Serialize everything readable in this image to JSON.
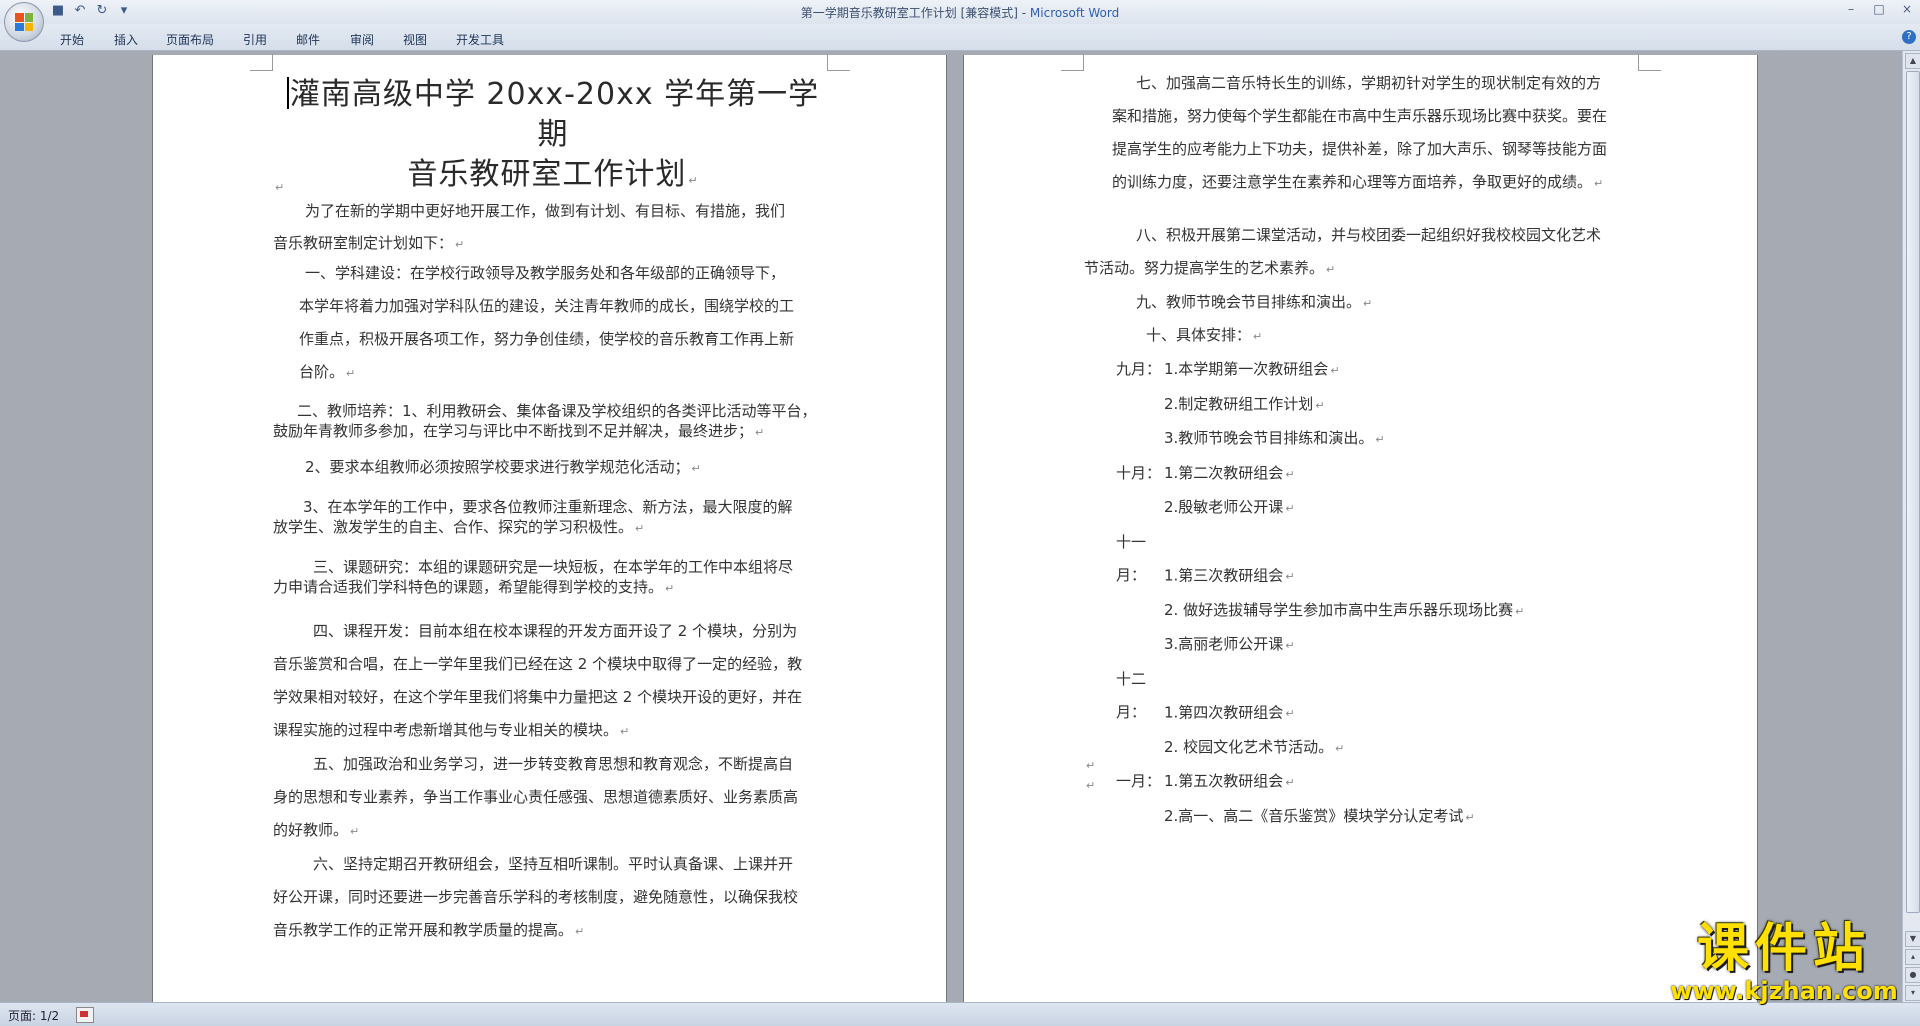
{
  "window": {
    "title": "第一学期音乐教研室工作计划 [兼容模式] - ",
    "app_name": "Microsoft Word",
    "controls": [
      "–",
      "□",
      "×"
    ]
  },
  "quick_access": [
    "save-icon",
    "undo-icon",
    "redo-icon",
    "customize-icon"
  ],
  "ribbon": {
    "tabs": [
      "开始",
      "插入",
      "页面布局",
      "引用",
      "邮件",
      "审阅",
      "视图",
      "开发工具"
    ],
    "help": "?"
  },
  "document": {
    "pilcrow": "↵",
    "left_page": {
      "title_line1": "灌南高级中学 20xx-20xx 学年第一学期",
      "title_line2": "音乐教研室工作计划",
      "intro_line1": "为了在新的学期中更好地开展工作，做到有计划、有目标、有措施，我们",
      "intro_line2": "音乐教研室制定计划如下：",
      "sec1_l1": "一、学科建设：在学校行政领导及教学服务处和各年级部的正确领导下，",
      "sec1_l2": "本学年将着力加强对学科队伍的建设，关注青年教师的成长，围绕学校的工",
      "sec1_l3": "作重点，积极开展各项工作，努力争创佳绩，使学校的音乐教育工作再上新",
      "sec1_l4": "台阶。",
      "sec2_l1": "二、教师培养：1、利用教研会、集体备课及学校组织的各类评比活动等平台，",
      "sec2_l2": "鼓励年青教师多参加，在学习与评比中不断找到不足并解决，最终进步；",
      "sec2_item2": "2、要求本组教师必须按照学校要求进行教学规范化活动；",
      "sec2_item3_l1": "3、在本学年的工作中，要求各位教师注重新理念、新方法，最大限度的解",
      "sec2_item3_l2": "放学生、激发学生的自主、合作、探究的学习积极性。",
      "sec3_l1": "三、课题研究：本组的课题研究是一块短板，在本学年的工作中本组将尽",
      "sec3_l2": "力申请合适我们学科特色的课题，希望能得到学校的支持。",
      "sec4_l1": "四、课程开发：目前本组在校本课程的开发方面开设了 2 个模块，分别为",
      "sec4_l2": "音乐鉴赏和合唱，在上一学年里我们已经在这 2 个模块中取得了一定的经验，教",
      "sec4_l3": "学效果相对较好，在这个学年里我们将集中力量把这 2 个模块开设的更好，并在",
      "sec4_l4": "课程实施的过程中考虑新增其他与专业相关的模块。",
      "sec5_l1": "五、加强政治和业务学习，进一步转变教育思想和教育观念，不断提高自",
      "sec5_l2": "身的思想和专业素养，争当工作事业心责任感强、思想道德素质好、业务素质高",
      "sec5_l3": "的好教师。",
      "sec6_l1": "六、坚持定期召开教研组会，坚持互相听课制。平时认真备课、上课并开",
      "sec6_l2": "好公开课，同时还要进一步完善音乐学科的考核制度，避免随意性，以确保我校",
      "sec6_l3": "音乐教学工作的正常开展和教学质量的提高。"
    },
    "right_page": {
      "sec7_l1": "七、加强高二音乐特长生的训练，学期初针对学生的现状制定有效的方",
      "sec7_l2": "案和措施，努力使每个学生都能在市高中生声乐器乐现场比赛中获奖。要在",
      "sec7_l3": "提高学生的应考能力上下功夫，提供补差，除了加大声乐、钢琴等技能方面",
      "sec7_l4": "的训练力度，还要注意学生在素养和心理等方面培养，争取更好的成绩。",
      "sec8_l1": "八、积极开展第二课堂活动，并与校团委一起组织好我校校园文化艺术",
      "sec8_l2": "节活动。努力提高学生的艺术素养。",
      "sec9": "九、教师节晚会节目排练和演出。",
      "sec10": "十、具体安排：",
      "schedule": [
        {
          "month": "九月：",
          "item": "1.本学期第一次教研组会"
        },
        {
          "month": "",
          "item": "2.制定教研组工作计划"
        },
        {
          "month": "",
          "item": "3.教师节晚会节目排练和演出。"
        },
        {
          "month": "十月：",
          "item": "1.第二次教研组会"
        },
        {
          "month": "",
          "item": "2.殷敏老师公开课"
        },
        {
          "month": "十一月：",
          "item": "1.第三次教研组会"
        },
        {
          "month": "",
          "item": "2. 做好选拔辅导学生参加市高中生声乐器乐现场比赛"
        },
        {
          "month": "",
          "item": "3.高丽老师公开课"
        },
        {
          "month": "十二月：",
          "item": "1.第四次教研组会"
        },
        {
          "month": "",
          "item": "2. 校园文化艺术节活动。"
        },
        {
          "month": "一月：",
          "item": "1.第五次教研组会"
        },
        {
          "month": "",
          "item": "2.高一、高二《音乐鉴赏》模块学分认定考试"
        }
      ]
    }
  },
  "status_bar": {
    "pages": "页面: 1/2"
  },
  "watermark": {
    "text": "课件站",
    "url": "www.kjzhan.com"
  }
}
